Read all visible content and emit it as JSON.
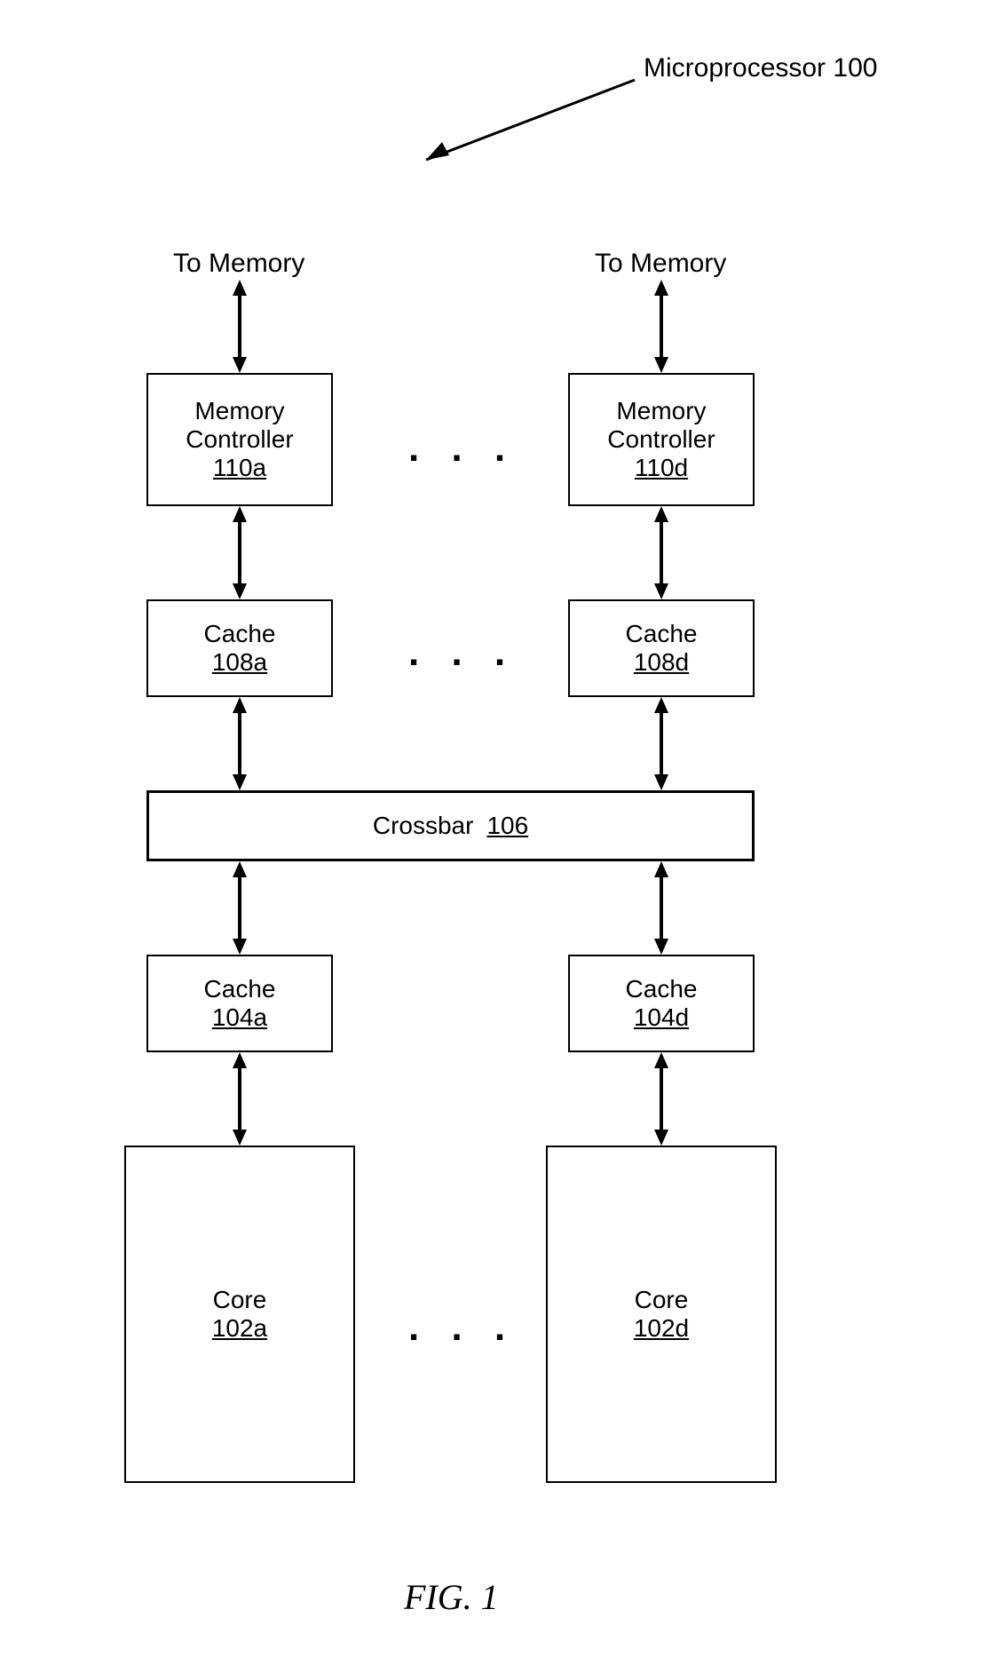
{
  "title": "Microprocessor 100",
  "to_memory": "To Memory",
  "memory_controller_left": {
    "label": "Memory\nController",
    "ref": "110a"
  },
  "memory_controller_right": {
    "label": "Memory\nController",
    "ref": "110d"
  },
  "cache_top_left": {
    "label": "Cache",
    "ref": "108a"
  },
  "cache_top_right": {
    "label": "Cache",
    "ref": "108d"
  },
  "crossbar": {
    "label": "Crossbar",
    "ref": "106"
  },
  "cache_bottom_left": {
    "label": "Cache",
    "ref": "104a"
  },
  "cache_bottom_right": {
    "label": "Cache",
    "ref": "104d"
  },
  "core_left": {
    "label": "Core",
    "ref": "102a"
  },
  "core_right": {
    "label": "Core",
    "ref": "102d"
  },
  "fig_label": "FIG. 1",
  "ellipsis": ". . ."
}
